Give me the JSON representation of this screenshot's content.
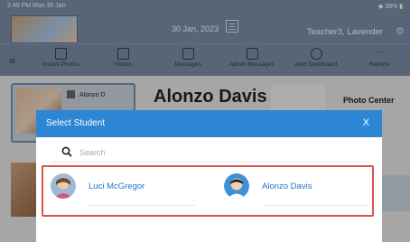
{
  "status_bar": {
    "time_date": "2:49 PM  Mon 30 Jan",
    "battery": "◆ 38% ▮"
  },
  "header": {
    "date": "30 Jan, 2023",
    "teacher": "Teacher3, Lavender",
    "settings_icon": "gear-icon"
  },
  "toolbar": {
    "items": [
      {
        "label": "Instant Photos",
        "icon": "photo-add-icon"
      },
      {
        "label": "Videos",
        "icon": "play-icon"
      },
      {
        "label": "Messages",
        "icon": "message-icon"
      },
      {
        "label": "Admin Messages",
        "icon": "admin-message-icon"
      },
      {
        "label": "Alert Dashboard",
        "icon": "alarm-clock-icon"
      },
      {
        "label": "Reports",
        "icon": "more-dots-icon"
      }
    ]
  },
  "background": {
    "card_name": "Alonzo D",
    "big_name": "Alonzo Davis",
    "photo_center": "Photo Center"
  },
  "modal": {
    "title": "Select Student",
    "close": "X",
    "search_placeholder": "Search",
    "students": [
      {
        "name": "Luci McGregor"
      },
      {
        "name": "Alonzo Davis"
      }
    ]
  },
  "colors": {
    "header": "#7b8da4",
    "modal_header": "#2c86d4",
    "link": "#1f73c4",
    "highlight_border": "#d9534f"
  }
}
